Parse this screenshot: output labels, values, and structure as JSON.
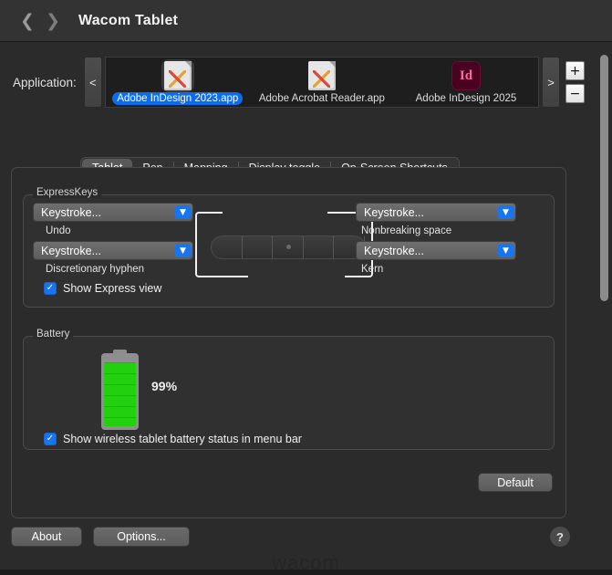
{
  "window": {
    "title": "Wacom Tablet",
    "back_icon": "chevron-left-icon",
    "forward_icon": "chevron-right-icon",
    "watermark": "wacom"
  },
  "application_bar": {
    "label": "Application:",
    "prev_label": "<",
    "next_label": ">",
    "add_label": "+",
    "remove_label": "−",
    "items": [
      {
        "name": "Adobe InDesign 2023.app",
        "icon": "document-app-icon",
        "selected": true
      },
      {
        "name": "Adobe Acrobat Reader.app",
        "icon": "document-app-icon",
        "selected": false
      },
      {
        "name": "Adobe InDesign 2025",
        "icon": "indesign-icon",
        "icon_text": "Id",
        "selected": false
      }
    ]
  },
  "tabs": [
    {
      "label": "Tablet",
      "active": true
    },
    {
      "label": "Pen",
      "active": false
    },
    {
      "label": "Mapping",
      "active": false
    },
    {
      "label": "Display toggle",
      "active": false
    },
    {
      "label": "On-Screen Shortcuts",
      "active": false
    }
  ],
  "expresskeys": {
    "title": "ExpressKeys",
    "keys": [
      {
        "position": "top-left",
        "value": "Keystroke...",
        "sublabel": "Undo"
      },
      {
        "position": "top-right",
        "value": "Keystroke...",
        "sublabel": "Nonbreaking space"
      },
      {
        "position": "bottom-left",
        "value": "Keystroke...",
        "sublabel": "Discretionary hyphen"
      },
      {
        "position": "bottom-right",
        "value": "Keystroke...",
        "sublabel": "Kern"
      }
    ],
    "dropdown_icon": "chevron-down-icon",
    "show_express_view": {
      "label": "Show Express view",
      "checked": true
    }
  },
  "battery": {
    "title": "Battery",
    "percent_label": "99%",
    "level": 99,
    "color": "#22d00e",
    "show_status": {
      "label": "Show wireless tablet battery status in menu bar",
      "checked": true
    }
  },
  "buttons": {
    "default": "Default",
    "about": "About",
    "options": "Options...",
    "help": "?"
  },
  "colors": {
    "accent_blue": "#1875f0",
    "selected_blue": "#0b6cf0",
    "battery_green": "#22d00e",
    "window_bg": "#2b2b2b"
  }
}
